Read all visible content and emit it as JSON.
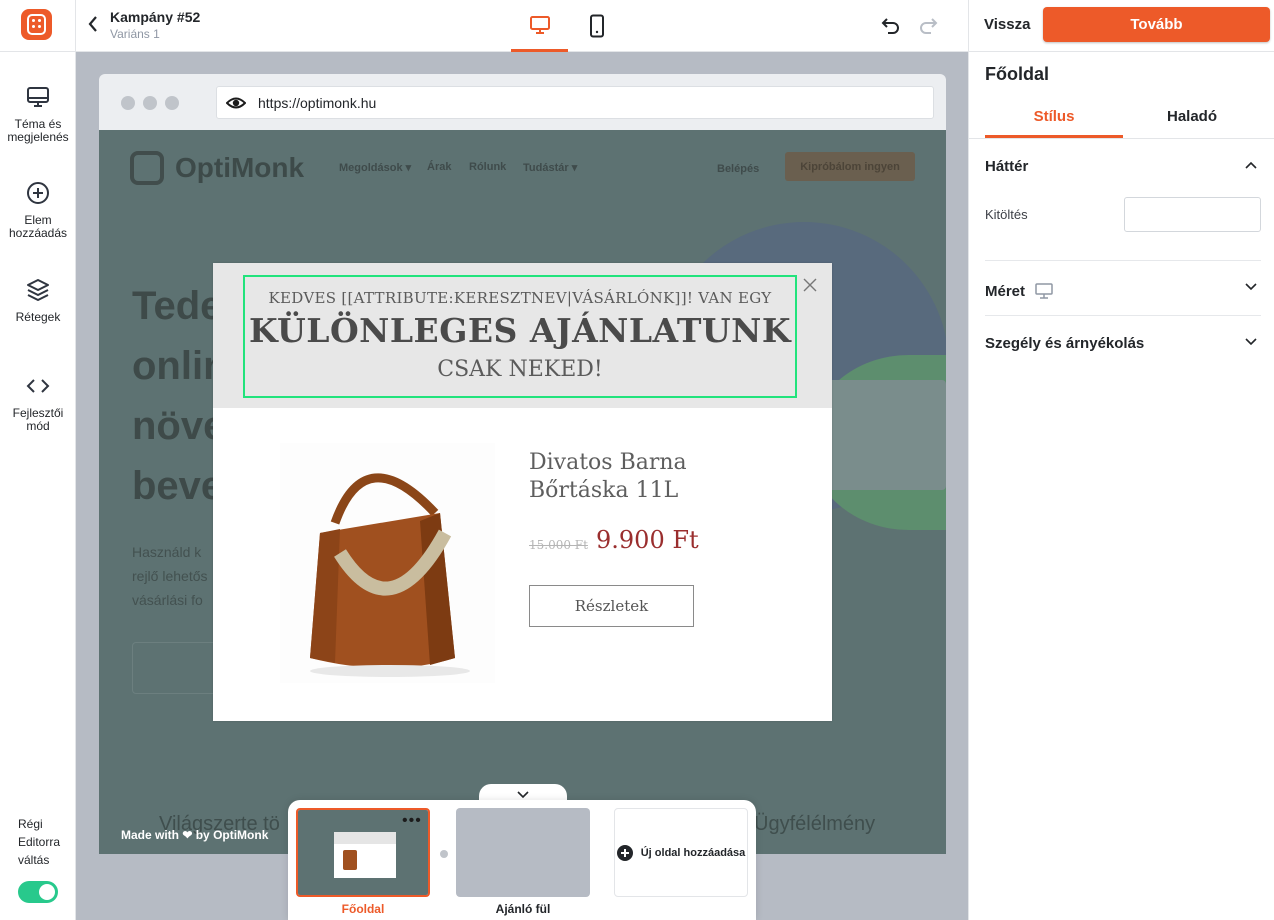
{
  "header": {
    "back_label": "‹",
    "campaign_title": "Kampány #52",
    "variant_label": "Variáns 1",
    "devices": [
      {
        "name": "desktop",
        "icon": "desktop-icon",
        "active": true
      },
      {
        "name": "mobile",
        "icon": "mobile-icon",
        "active": false
      }
    ],
    "back_button": "Vissza",
    "next_button": "Tovább",
    "accent_color": "#ed5a29"
  },
  "sidebar": {
    "items": [
      {
        "icon": "monitor-icon",
        "label": "Téma és megjelenés"
      },
      {
        "icon": "plus-circle-icon",
        "label": "Elem hozzáadás"
      },
      {
        "icon": "layers-icon",
        "label": "Rétegek"
      },
      {
        "icon": "code-icon",
        "label": "Fejlesztői mód"
      }
    ],
    "legacy_toggle_label": "Régi Editorra váltás",
    "legacy_toggle_on": true
  },
  "preview": {
    "url": "https://optimonk.hu",
    "made_with": "Made with ❤ by OptiMonk",
    "site": {
      "brand": "OptiMonk",
      "nav": [
        "Megoldások ▾",
        "Árak",
        "Rólunk",
        "Tudástár ▾"
      ],
      "login": "Belépés",
      "cta": "Kipróbálom ingyen",
      "headline_fragments": [
        "Tede",
        "onlin",
        "növe",
        "beve"
      ],
      "body_fragments": [
        "Használd k",
        "rejlő lehetős",
        "vásárlási fo"
      ],
      "bottom_text_left": "Világszerte tö",
      "bottom_text_right": "Ügyfélélmény"
    },
    "popup": {
      "line1": "KEDVES [[ATTRIBUTE:KERESZTNEV|VÁSÁRLÓNK]]! VAN EGY",
      "line2": "KÜLÖNLEGES AJÁNLATUNK",
      "line3": "CSAK NEKED!",
      "product_title": "Divatos Barna Bőrtáska 11L",
      "old_price": "15.000 Ft",
      "new_price": "9.900 Ft",
      "details_button": "Részletek"
    }
  },
  "pages": {
    "items": [
      {
        "label": "Főoldal",
        "selected": true
      },
      {
        "label": "Ajánló fül",
        "selected": false
      }
    ],
    "add_page_label": "Új oldal hozzáadása"
  },
  "panel": {
    "title": "Főoldal",
    "tabs": [
      {
        "label": "Stílus",
        "active": true
      },
      {
        "label": "Haladó",
        "active": false
      }
    ],
    "sections": {
      "background": "Háttér",
      "fill_label": "Kitöltés",
      "size": "Méret",
      "border_shadow": "Szegély és árnyékolás"
    }
  }
}
